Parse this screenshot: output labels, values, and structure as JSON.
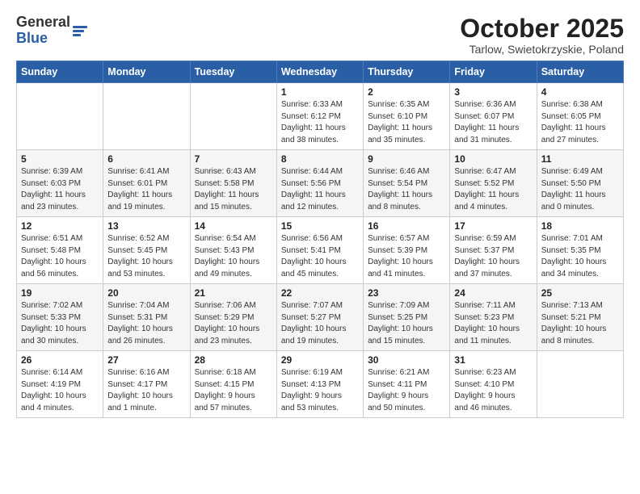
{
  "header": {
    "logo_general": "General",
    "logo_blue": "Blue",
    "month_title": "October 2025",
    "location": "Tarlow, Swietokrzyskie, Poland"
  },
  "weekdays": [
    "Sunday",
    "Monday",
    "Tuesday",
    "Wednesday",
    "Thursday",
    "Friday",
    "Saturday"
  ],
  "weeks": [
    [
      {
        "day": "",
        "info": ""
      },
      {
        "day": "",
        "info": ""
      },
      {
        "day": "",
        "info": ""
      },
      {
        "day": "1",
        "info": "Sunrise: 6:33 AM\nSunset: 6:12 PM\nDaylight: 11 hours\nand 38 minutes."
      },
      {
        "day": "2",
        "info": "Sunrise: 6:35 AM\nSunset: 6:10 PM\nDaylight: 11 hours\nand 35 minutes."
      },
      {
        "day": "3",
        "info": "Sunrise: 6:36 AM\nSunset: 6:07 PM\nDaylight: 11 hours\nand 31 minutes."
      },
      {
        "day": "4",
        "info": "Sunrise: 6:38 AM\nSunset: 6:05 PM\nDaylight: 11 hours\nand 27 minutes."
      }
    ],
    [
      {
        "day": "5",
        "info": "Sunrise: 6:39 AM\nSunset: 6:03 PM\nDaylight: 11 hours\nand 23 minutes."
      },
      {
        "day": "6",
        "info": "Sunrise: 6:41 AM\nSunset: 6:01 PM\nDaylight: 11 hours\nand 19 minutes."
      },
      {
        "day": "7",
        "info": "Sunrise: 6:43 AM\nSunset: 5:58 PM\nDaylight: 11 hours\nand 15 minutes."
      },
      {
        "day": "8",
        "info": "Sunrise: 6:44 AM\nSunset: 5:56 PM\nDaylight: 11 hours\nand 12 minutes."
      },
      {
        "day": "9",
        "info": "Sunrise: 6:46 AM\nSunset: 5:54 PM\nDaylight: 11 hours\nand 8 minutes."
      },
      {
        "day": "10",
        "info": "Sunrise: 6:47 AM\nSunset: 5:52 PM\nDaylight: 11 hours\nand 4 minutes."
      },
      {
        "day": "11",
        "info": "Sunrise: 6:49 AM\nSunset: 5:50 PM\nDaylight: 11 hours\nand 0 minutes."
      }
    ],
    [
      {
        "day": "12",
        "info": "Sunrise: 6:51 AM\nSunset: 5:48 PM\nDaylight: 10 hours\nand 56 minutes."
      },
      {
        "day": "13",
        "info": "Sunrise: 6:52 AM\nSunset: 5:45 PM\nDaylight: 10 hours\nand 53 minutes."
      },
      {
        "day": "14",
        "info": "Sunrise: 6:54 AM\nSunset: 5:43 PM\nDaylight: 10 hours\nand 49 minutes."
      },
      {
        "day": "15",
        "info": "Sunrise: 6:56 AM\nSunset: 5:41 PM\nDaylight: 10 hours\nand 45 minutes."
      },
      {
        "day": "16",
        "info": "Sunrise: 6:57 AM\nSunset: 5:39 PM\nDaylight: 10 hours\nand 41 minutes."
      },
      {
        "day": "17",
        "info": "Sunrise: 6:59 AM\nSunset: 5:37 PM\nDaylight: 10 hours\nand 37 minutes."
      },
      {
        "day": "18",
        "info": "Sunrise: 7:01 AM\nSunset: 5:35 PM\nDaylight: 10 hours\nand 34 minutes."
      }
    ],
    [
      {
        "day": "19",
        "info": "Sunrise: 7:02 AM\nSunset: 5:33 PM\nDaylight: 10 hours\nand 30 minutes."
      },
      {
        "day": "20",
        "info": "Sunrise: 7:04 AM\nSunset: 5:31 PM\nDaylight: 10 hours\nand 26 minutes."
      },
      {
        "day": "21",
        "info": "Sunrise: 7:06 AM\nSunset: 5:29 PM\nDaylight: 10 hours\nand 23 minutes."
      },
      {
        "day": "22",
        "info": "Sunrise: 7:07 AM\nSunset: 5:27 PM\nDaylight: 10 hours\nand 19 minutes."
      },
      {
        "day": "23",
        "info": "Sunrise: 7:09 AM\nSunset: 5:25 PM\nDaylight: 10 hours\nand 15 minutes."
      },
      {
        "day": "24",
        "info": "Sunrise: 7:11 AM\nSunset: 5:23 PM\nDaylight: 10 hours\nand 11 minutes."
      },
      {
        "day": "25",
        "info": "Sunrise: 7:13 AM\nSunset: 5:21 PM\nDaylight: 10 hours\nand 8 minutes."
      }
    ],
    [
      {
        "day": "26",
        "info": "Sunrise: 6:14 AM\nSunset: 4:19 PM\nDaylight: 10 hours\nand 4 minutes."
      },
      {
        "day": "27",
        "info": "Sunrise: 6:16 AM\nSunset: 4:17 PM\nDaylight: 10 hours\nand 1 minute."
      },
      {
        "day": "28",
        "info": "Sunrise: 6:18 AM\nSunset: 4:15 PM\nDaylight: 9 hours\nand 57 minutes."
      },
      {
        "day": "29",
        "info": "Sunrise: 6:19 AM\nSunset: 4:13 PM\nDaylight: 9 hours\nand 53 minutes."
      },
      {
        "day": "30",
        "info": "Sunrise: 6:21 AM\nSunset: 4:11 PM\nDaylight: 9 hours\nand 50 minutes."
      },
      {
        "day": "31",
        "info": "Sunrise: 6:23 AM\nSunset: 4:10 PM\nDaylight: 9 hours\nand 46 minutes."
      },
      {
        "day": "",
        "info": ""
      }
    ]
  ]
}
